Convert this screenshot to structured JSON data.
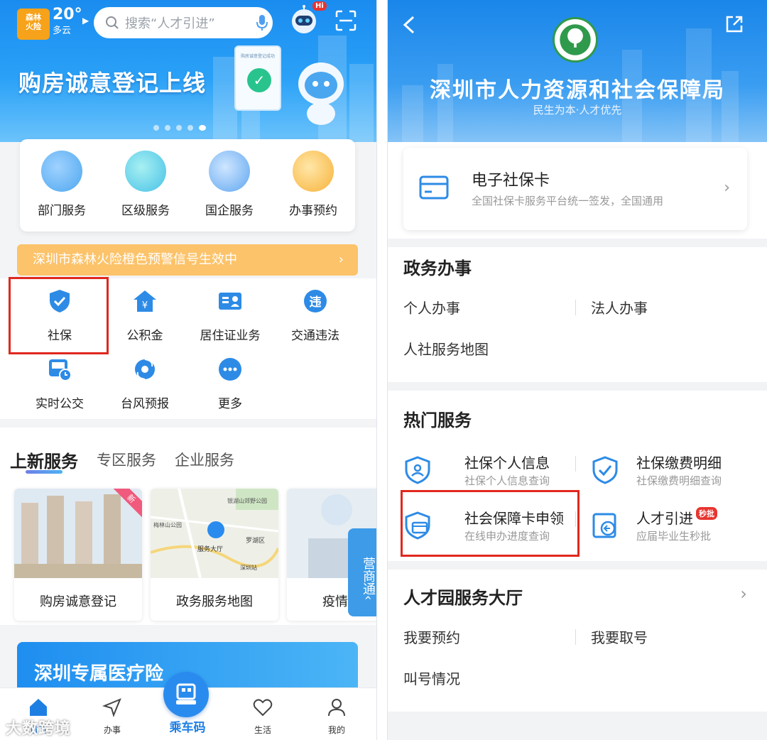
{
  "left": {
    "weather": {
      "badge": "森林\n火险",
      "temp": "20°",
      "desc": "多云"
    },
    "search": {
      "placeholder": "搜索“人才引进”"
    },
    "robot": {
      "badge": "Hi"
    },
    "banner": {
      "title": "购房诚意登记上线",
      "card_caption": "购房诚意登记成功"
    },
    "quick_services": [
      {
        "label": "部门服务",
        "icon": "department-icon",
        "color": "#4ea7ef"
      },
      {
        "label": "区级服务",
        "icon": "district-icon",
        "color": "#46c1e6"
      },
      {
        "label": "国企服务",
        "icon": "soe-icon",
        "color": "#5fa6f0"
      },
      {
        "label": "办事预约",
        "icon": "appointment-icon",
        "color": "#f7b23a"
      }
    ],
    "alert": {
      "text": "深圳市森林火险橙色预警信号生效中"
    },
    "grid": [
      {
        "label": "社保",
        "icon": "shield-check-icon"
      },
      {
        "label": "公积金",
        "icon": "housing-fund-icon"
      },
      {
        "label": "居住证业务",
        "icon": "id-card-icon"
      },
      {
        "label": "交通违法",
        "icon": "traffic-violation-icon"
      },
      {
        "label": "实时公交",
        "icon": "bus-icon"
      },
      {
        "label": "台风预报",
        "icon": "typhoon-icon"
      },
      {
        "label": "更多",
        "icon": "more-icon"
      }
    ],
    "service_tabs": [
      "上新服务",
      "专区服务",
      "企业服务"
    ],
    "service_cards": [
      {
        "label": "购房诚意登记",
        "tag": "新"
      },
      {
        "label": "政务服务地图",
        "map_labels": [
          "银湖山郊野公园",
          "梅林山公园",
          "服务大厅",
          "罗湖区",
          "深圳站"
        ]
      },
      {
        "label": "疫情"
      }
    ],
    "side_tab": "营商通",
    "side_tab_icon": "chevron-left-icon",
    "medical_banner": {
      "title": "深圳专属医疗险"
    },
    "tabbar": {
      "home": "首页",
      "affairs": "办事",
      "ride": "乘车码",
      "life": "生活",
      "me": "我的"
    },
    "watermark": "大数跨境",
    "colors": {
      "primary": "#1e7fe3",
      "alert": "#fcc36a",
      "highlight": "#e0281e"
    }
  },
  "right": {
    "header": {
      "title": "深圳市人力资源和社会保障局",
      "subtitle": "民生为本·人才优先"
    },
    "ecard": {
      "title": "电子社保卡",
      "desc": "全国社保卡服务平台统一签发，全国通用"
    },
    "gov_affairs": {
      "title": "政务办事",
      "links": [
        "个人办事",
        "法人办事",
        "人社服务地图"
      ]
    },
    "hot_services": {
      "title": "热门服务",
      "items": [
        {
          "title": "社保个人信息",
          "desc": "社保个人信息查询",
          "icon": "personal-info-icon"
        },
        {
          "title": "社保缴费明细",
          "desc": "社保缴费明细查询",
          "icon": "payment-detail-icon"
        },
        {
          "title": "社会保障卡申领",
          "desc": "在线申办进度查询",
          "icon": "card-apply-icon"
        },
        {
          "title": "人才引进",
          "desc": "应届毕业生秒批",
          "badge": "秒批",
          "icon": "talent-icon"
        }
      ]
    },
    "talent_hall": {
      "title": "人才园服务大厅",
      "links": [
        "我要预约",
        "我要取号",
        "叫号情况"
      ]
    }
  }
}
